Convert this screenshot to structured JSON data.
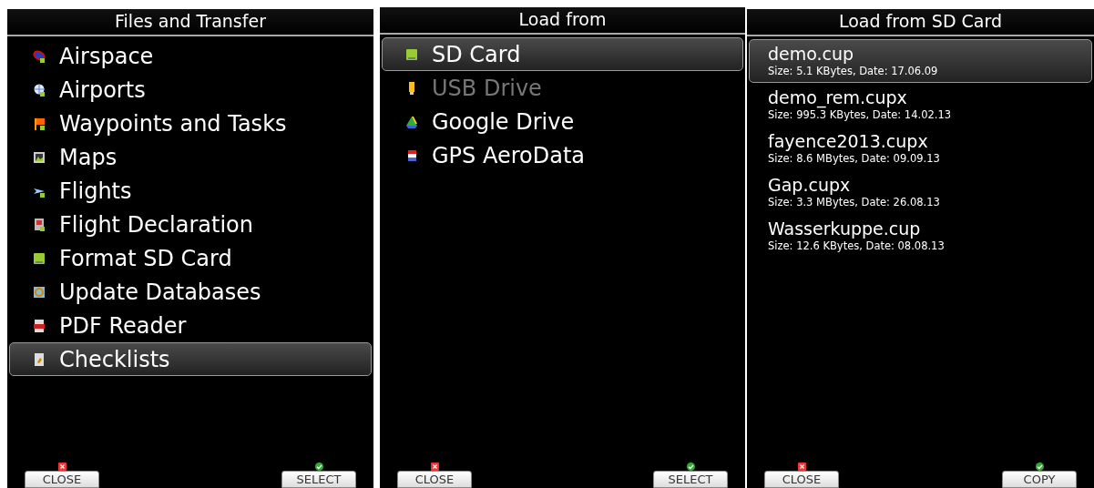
{
  "panels": [
    {
      "title": "Files and Transfer",
      "kind": "menu",
      "items": [
        {
          "label": "Airspace",
          "selected": false,
          "disabled": false
        },
        {
          "label": "Airports",
          "selected": false,
          "disabled": false
        },
        {
          "label": "Waypoints and Tasks",
          "selected": false,
          "disabled": false
        },
        {
          "label": "Maps",
          "selected": false,
          "disabled": false
        },
        {
          "label": "Flights",
          "selected": false,
          "disabled": false
        },
        {
          "label": "Flight Declaration",
          "selected": false,
          "disabled": false
        },
        {
          "label": "Format SD Card",
          "selected": false,
          "disabled": false
        },
        {
          "label": "Update Databases",
          "selected": false,
          "disabled": false
        },
        {
          "label": "PDF Reader",
          "selected": false,
          "disabled": false
        },
        {
          "label": "Checklists",
          "selected": true,
          "disabled": false
        }
      ],
      "buttons": [
        {
          "label": "CLOSE",
          "kind": "close"
        },
        {
          "label": "SELECT",
          "kind": "confirm"
        }
      ]
    },
    {
      "title": "Load from",
      "kind": "menu",
      "items": [
        {
          "label": "SD Card",
          "selected": true,
          "disabled": false
        },
        {
          "label": "USB Drive",
          "selected": false,
          "disabled": true
        },
        {
          "label": "Google Drive",
          "selected": false,
          "disabled": false
        },
        {
          "label": "GPS AeroData",
          "selected": false,
          "disabled": false
        }
      ],
      "buttons": [
        {
          "label": "CLOSE",
          "kind": "close"
        },
        {
          "label": "SELECT",
          "kind": "confirm"
        }
      ]
    },
    {
      "title": "Load from SD Card",
      "kind": "files",
      "items": [
        {
          "label": "demo.cup",
          "detail": "Size: 5.1 KBytes, Date: 17.06.09",
          "selected": true,
          "disabled": false
        },
        {
          "label": "demo_rem.cupx",
          "detail": "Size: 995.3 KBytes, Date: 14.02.13",
          "selected": false,
          "disabled": false
        },
        {
          "label": "fayence2013.cupx",
          "detail": "Size: 8.6 MBytes, Date: 09.09.13",
          "selected": false,
          "disabled": false
        },
        {
          "label": "Gap.cupx",
          "detail": "Size: 3.3 MBytes, Date: 26.08.13",
          "selected": false,
          "disabled": false
        },
        {
          "label": "Wasserkuppe.cup",
          "detail": "Size: 12.6 KBytes, Date: 08.08.13",
          "selected": false,
          "disabled": false
        }
      ],
      "buttons": [
        {
          "label": "CLOSE",
          "kind": "close"
        },
        {
          "label": "COPY",
          "kind": "confirm"
        }
      ]
    }
  ]
}
